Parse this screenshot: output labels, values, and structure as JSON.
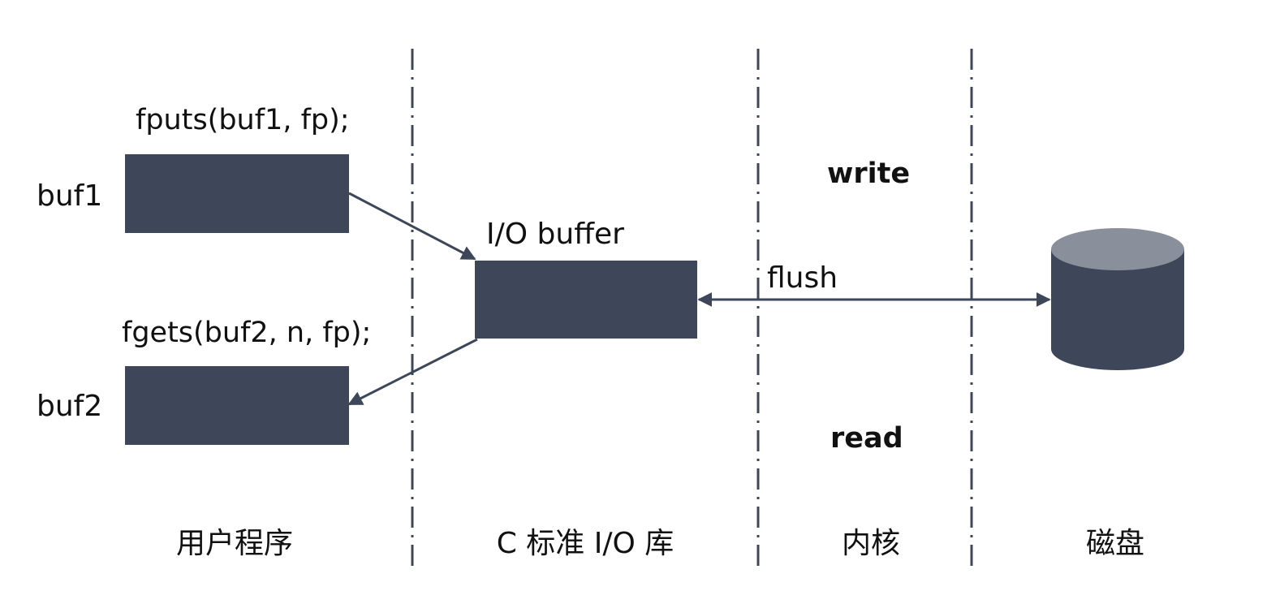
{
  "colors": {
    "box_fill": "#3d4759",
    "disk_top": "#8a8f9c",
    "disk_body": "#3d4759",
    "line": "#3d4759",
    "text": "#111111"
  },
  "code": {
    "fputs": "fputs(buf1, fp);",
    "fgets": "fgets(buf2, n, fp);"
  },
  "buffers": {
    "buf1": "buf1",
    "buf2": "buf2",
    "io_buffer": "I/O buffer"
  },
  "operations": {
    "flush": "flush",
    "write": "write",
    "read": "read"
  },
  "regions": {
    "user_program": "用户程序",
    "c_stdio": "C 标准 I/O 库",
    "kernel": "内核",
    "disk": "磁盘"
  },
  "icons": {
    "disk": "disk-cylinder-icon"
  }
}
